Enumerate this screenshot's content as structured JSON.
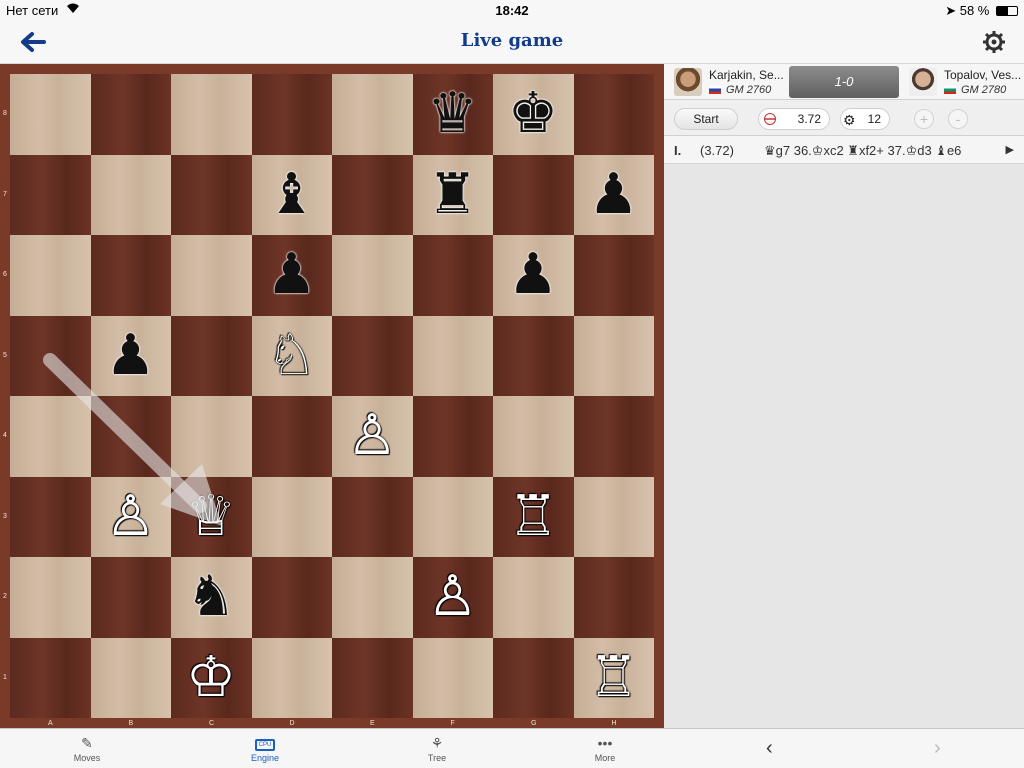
{
  "status": {
    "carrier": "Нет сети",
    "time": "18:42",
    "battery": "58 %"
  },
  "navbar": {
    "title": "Live game"
  },
  "board": {
    "files": [
      "A",
      "B",
      "C",
      "D",
      "E",
      "F",
      "G",
      "H"
    ],
    "ranks": [
      "8",
      "7",
      "6",
      "5",
      "4",
      "3",
      "2",
      "1"
    ],
    "pieces": [
      {
        "square": "f8",
        "piece": "♛",
        "color": "black",
        "name": "black-queen"
      },
      {
        "square": "g8",
        "piece": "♚",
        "color": "black",
        "name": "black-king"
      },
      {
        "square": "d7",
        "piece": "♝",
        "color": "black",
        "name": "black-bishop"
      },
      {
        "square": "f7",
        "piece": "♜",
        "color": "black",
        "name": "black-rook"
      },
      {
        "square": "h7",
        "piece": "♟",
        "color": "black",
        "name": "black-pawn"
      },
      {
        "square": "d6",
        "piece": "♟",
        "color": "black",
        "name": "black-pawn"
      },
      {
        "square": "g6",
        "piece": "♟",
        "color": "black",
        "name": "black-pawn"
      },
      {
        "square": "b5",
        "piece": "♟",
        "color": "black",
        "name": "black-pawn"
      },
      {
        "square": "d5",
        "piece": "♘",
        "color": "white",
        "name": "white-knight"
      },
      {
        "square": "e4",
        "piece": "♙",
        "color": "white",
        "name": "white-pawn"
      },
      {
        "square": "b3",
        "piece": "♙",
        "color": "white",
        "name": "white-pawn"
      },
      {
        "square": "c3",
        "piece": "♕",
        "color": "white",
        "name": "white-queen"
      },
      {
        "square": "g3",
        "piece": "♖",
        "color": "white",
        "name": "white-rook"
      },
      {
        "square": "c2",
        "piece": "♞",
        "color": "black",
        "name": "black-knight"
      },
      {
        "square": "f2",
        "piece": "♙",
        "color": "white",
        "name": "white-pawn"
      },
      {
        "square": "c1",
        "piece": "♔",
        "color": "white",
        "name": "white-king"
      },
      {
        "square": "h1",
        "piece": "♖",
        "color": "white",
        "name": "white-rook"
      }
    ],
    "highlight_arrow": {
      "from": "a5",
      "to": "c3"
    }
  },
  "players": {
    "white": {
      "name": "Karjakin, Se...",
      "rating": "GM 2760",
      "flag": "russia"
    },
    "result": "1-0",
    "black": {
      "name": "Topalov, Ves...",
      "rating": "GM 2780",
      "flag": "bulgaria"
    }
  },
  "engine_toolbar": {
    "start_label": "Start",
    "eval": "3.72",
    "depth": "12",
    "plus": "+",
    "minus": "-"
  },
  "engine_line": {
    "index": "I.",
    "score": "(3.72)",
    "moves": "♛g7 36.♔xc2 ♜xf2+ 37.♔d3 ♝e6"
  },
  "tabs": [
    {
      "label": "Moves",
      "icon": "pencil-icon"
    },
    {
      "label": "Engine",
      "icon": "cpu-icon",
      "active": true
    },
    {
      "label": "Tree",
      "icon": "tree-icon"
    },
    {
      "label": "More",
      "icon": "more-icon"
    }
  ],
  "colors": {
    "accent": "#123c8a",
    "active_tab": "#1a5fc4",
    "board_frame": "#7a3a28"
  }
}
